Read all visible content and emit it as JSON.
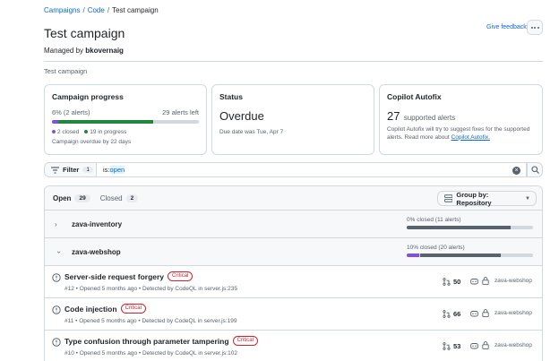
{
  "breadcrumb": {
    "campaigns": "Campaigns",
    "code": "Code",
    "sep1": "/",
    "sep2": "/",
    "current": "Test campaign"
  },
  "header": {
    "title": "Test campaign",
    "managed_prefix": "Managed by",
    "manager": "bkovernaig",
    "feedback": "Give feedback",
    "description": "Test campaign"
  },
  "progress_card": {
    "title": "Campaign progress",
    "percent_text": "6% (2 alerts)",
    "alerts_left": "29 alerts left",
    "closed_fraction": 0.69,
    "closed_label": "2 closed",
    "in_progress_label": "19 in progress",
    "overdue_note": "Campaign overdue by 22 days"
  },
  "status_card": {
    "title": "Status",
    "value": "Overdue",
    "due": "Due date was Tue, Apr 7"
  },
  "autofix_card": {
    "title": "Copilot Autofix",
    "count": "27",
    "count_label": "supported alerts",
    "note": "Copilot Autofix will try to suggest fixes for the supported alerts. Read more about",
    "link": "Copilot Autofix."
  },
  "filter": {
    "label": "Filter",
    "count": "1",
    "query_key": "is:",
    "query_value": "open"
  },
  "tabs": {
    "open_label": "Open",
    "open_count": "29",
    "closed_label": "Closed",
    "closed_count": "2"
  },
  "group_by": {
    "label": "Group by: Repository"
  },
  "repos": [
    {
      "name": "zava-inventory",
      "stat": "0% closed (11 alerts)",
      "closed_fraction": 0.0,
      "dark_fraction": 0.82
    },
    {
      "name": "zava-webshop",
      "stat": "10% closed (20 alerts)",
      "closed_fraction": 0.1,
      "dark_fraction": 0.74
    }
  ],
  "alerts": [
    {
      "title": "Server-side request forgery",
      "severity": "Critical",
      "meta": "#12 • Opened 5 months ago • Detected by CodeQL in server.js:235",
      "pr_count": "50",
      "repo": "zava-webshop"
    },
    {
      "title": "Code injection",
      "severity": "Critical",
      "meta": "#11 • Opened 5 months ago • Detected by CodeQL in server.js:199",
      "pr_count": "66",
      "repo": "zava-webshop"
    },
    {
      "title": "Type confusion through parameter tampering",
      "severity": "Critical",
      "meta": "#10 • Opened 5 months ago • Detected by CodeQL in server.js:102",
      "pr_count": "53",
      "repo": "zava-webshop"
    }
  ],
  "colors": {
    "accent": "#0969da",
    "success": "#1f883d",
    "purple": "#8250df",
    "danger": "#cf222e"
  }
}
